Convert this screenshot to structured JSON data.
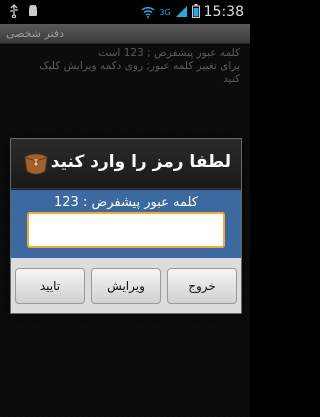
{
  "status_bar": {
    "time": "15:38",
    "icons": [
      "usb-icon",
      "android-debug-icon",
      "wifi-icon",
      "signal-icon",
      "battery-icon"
    ],
    "network": "3G"
  },
  "app": {
    "title": "دفتر شخصی"
  },
  "background_message": {
    "line1": "کلمه عبور پیشفرض ; 123 است",
    "line2": "برای تغییر کلمه عبور; روی دکمه ویرایش کلیک",
    "line3": "کنید"
  },
  "dialog": {
    "title": "لطفا رمز را وارد کنید",
    "label": "کلمه عبور پیشفرض : 123",
    "input_value": "",
    "buttons": {
      "exit": "خروج",
      "edit": "ویرایش",
      "confirm": "تایید"
    }
  },
  "colors": {
    "dialog_body": "#3d6a9e",
    "input_focus_border": "#f2a93b",
    "button_bar": "#dcdcdc"
  }
}
